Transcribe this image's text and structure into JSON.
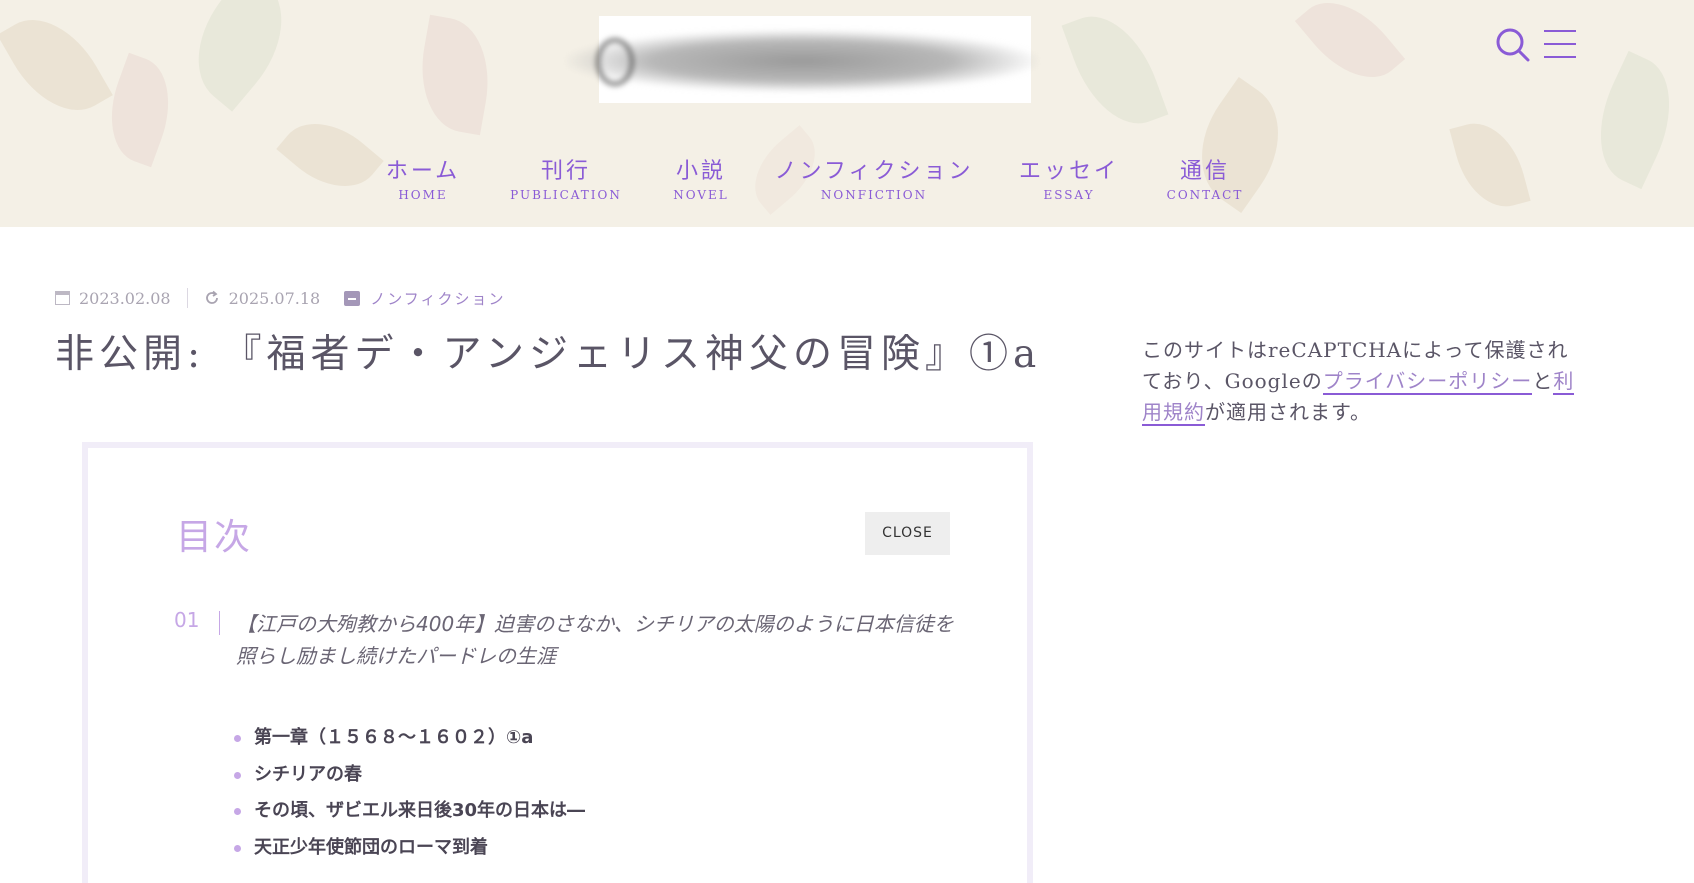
{
  "nav": {
    "items": [
      {
        "jp": "ホーム",
        "en": "HOME"
      },
      {
        "jp": "刊行",
        "en": "PUBLICATION"
      },
      {
        "jp": "小説",
        "en": "NOVEL"
      },
      {
        "jp": "ノンフィクション",
        "en": "NONFICTION"
      },
      {
        "jp": "エッセイ",
        "en": "ESSAY"
      },
      {
        "jp": "通信",
        "en": "CONTACT"
      }
    ]
  },
  "icons": {
    "search": "search-icon",
    "menu": "hamburger-menu-icon",
    "calendar": "calendar-icon",
    "updated": "refresh-icon",
    "category": "archive-icon"
  },
  "colors": {
    "accent": "#8a5bd6",
    "accent_light": "#c6a7e6",
    "text": "#5a5566",
    "meta": "#a9a4b1"
  },
  "post": {
    "published": "2023.02.08",
    "updated": "2025.07.18",
    "category": "ノンフィクション",
    "title": "非公開: 『福者デ・アンジェリス神父の冒険』①a"
  },
  "sidebar": {
    "text_1": "このサイトはreCAPTCHAによって保護されており、Googleの",
    "privacy_link": "プライバシーポリシー",
    "text_2": "と",
    "terms_link": "利用規約",
    "text_3": "が適用されます。"
  },
  "toc": {
    "title": "目次",
    "close_label": "CLOSE",
    "item_number": "01",
    "item_text": "【江戸の大殉教から400年】迫害のさなか、シチリアの太陽のように日本信徒を照らし励まし続けたパードレの生涯",
    "subitems": [
      "第一章（１５６８〜１６０２）①a",
      "シチリアの春",
      "その頃、ザビエル来日後30年の日本は―",
      "天正少年使節団のローマ到着"
    ]
  }
}
